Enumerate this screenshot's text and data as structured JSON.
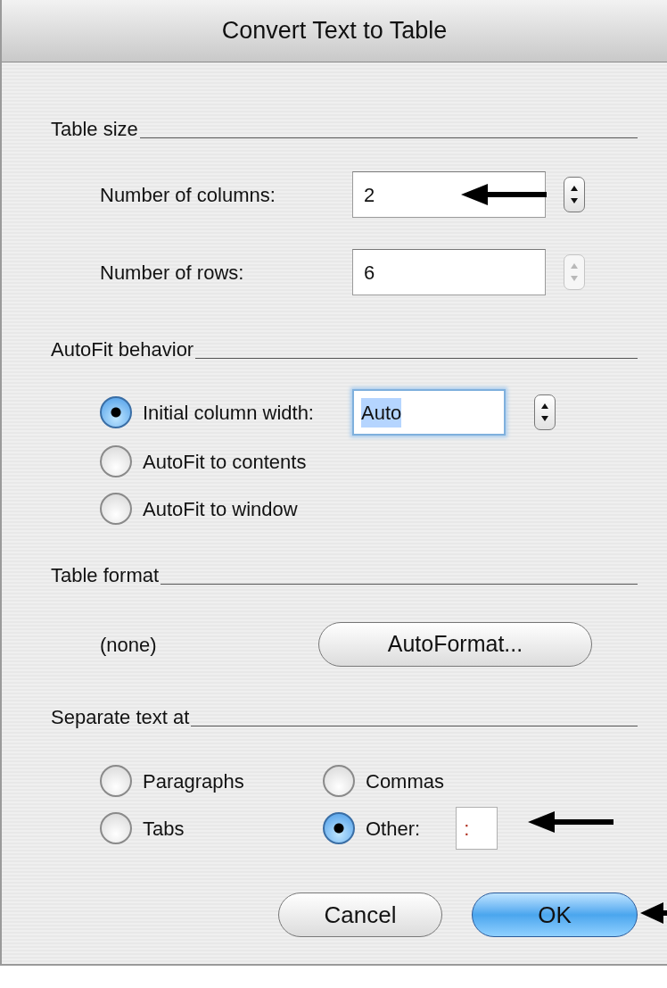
{
  "window": {
    "title": "Convert Text to Table"
  },
  "table_size": {
    "heading": "Table size",
    "fields": [
      {
        "label": "Number of columns:",
        "value": "2",
        "disabled": false
      },
      {
        "label": "Number of rows:",
        "value": "6",
        "disabled": true
      }
    ]
  },
  "autofit": {
    "heading": "AutoFit behavior",
    "options": [
      {
        "label": "Initial column width:",
        "selected": true
      },
      {
        "label": "AutoFit to contents",
        "selected": false
      },
      {
        "label": "AutoFit to window",
        "selected": false
      }
    ],
    "width_field": {
      "value": "Auto",
      "focused": true
    }
  },
  "table_format": {
    "heading": "Table format",
    "current": "(none)",
    "button": "AutoFormat..."
  },
  "separate": {
    "heading": "Separate text at",
    "options": [
      {
        "label": "Paragraphs",
        "selected": false
      },
      {
        "label": "Commas",
        "selected": false
      },
      {
        "label": "Tabs",
        "selected": false
      },
      {
        "label": "Other:",
        "selected": true
      }
    ],
    "other_value": ":"
  },
  "buttons": [
    {
      "label": "Cancel",
      "default": false
    },
    {
      "label": "OK",
      "default": true
    }
  ]
}
